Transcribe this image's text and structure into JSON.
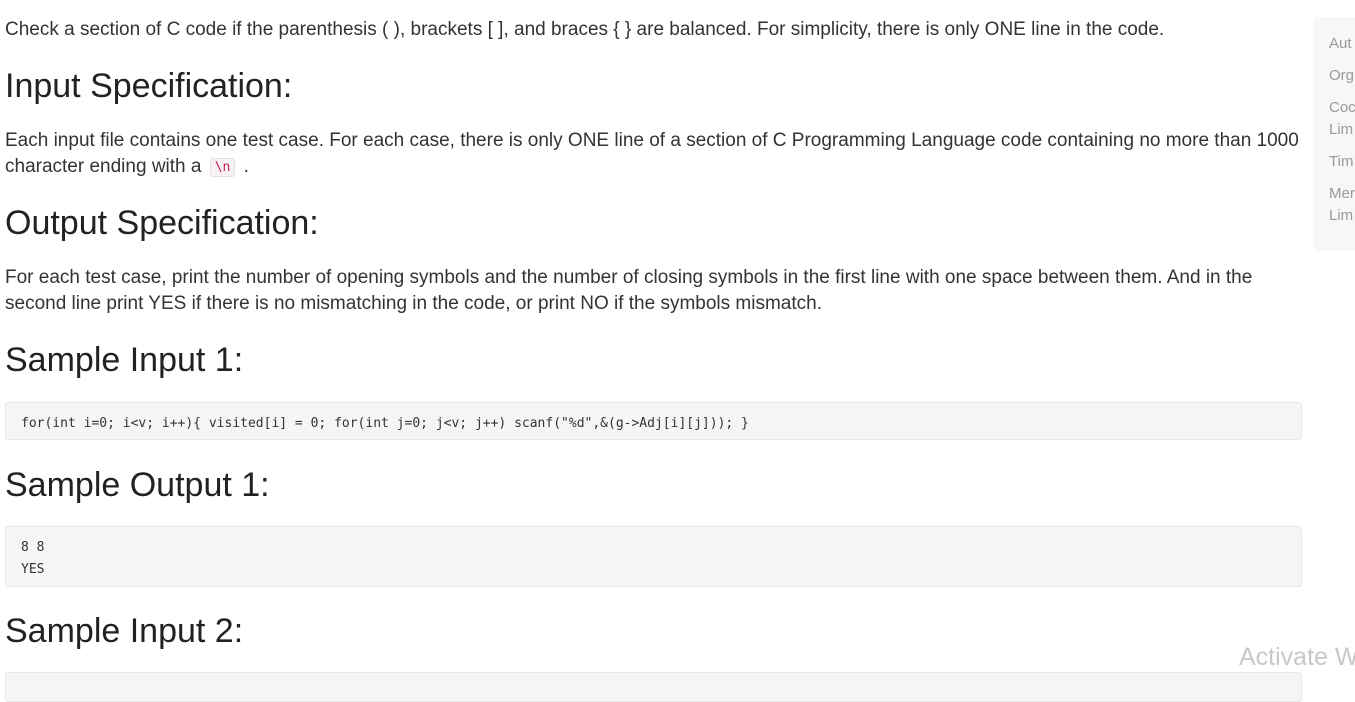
{
  "problem": {
    "intro": "Check a section of C code if the parenthesis ( ), brackets [ ], and braces { } are balanced. For simplicity, there is only ONE line in the code.",
    "input_spec": {
      "heading": "Input Specification:",
      "text_before": "Each input file contains one test case. For each case, there is only ONE line of a section of C Programming Language code containing no more than 1000 character ending with a",
      "code": "\\n",
      "text_after": "."
    },
    "output_spec": {
      "heading": "Output Specification:",
      "text": "For each test case, print the number of opening symbols and the number of closing symbols in the first line with one space between them. And in the second line print YES if there is no mismatching in the code, or print NO if the symbols mismatch."
    },
    "sample_input_1": {
      "heading": "Sample Input 1:",
      "code": "for(int i=0; i<v; i++){ visited[i] = 0; for(int j=0; j<v; j++) scanf(\"%d\",&(g->Adj[i][j])); }"
    },
    "sample_output_1": {
      "heading": "Sample Output 1:",
      "code": "8 8\nYES"
    },
    "sample_input_2": {
      "heading": "Sample Input 2:",
      "code": ""
    }
  },
  "sidebar": {
    "items": [
      "Aut",
      "Org",
      "Coc",
      "Lim",
      "Tim",
      "Mer",
      "Lim"
    ]
  },
  "watermark": "Activate W"
}
